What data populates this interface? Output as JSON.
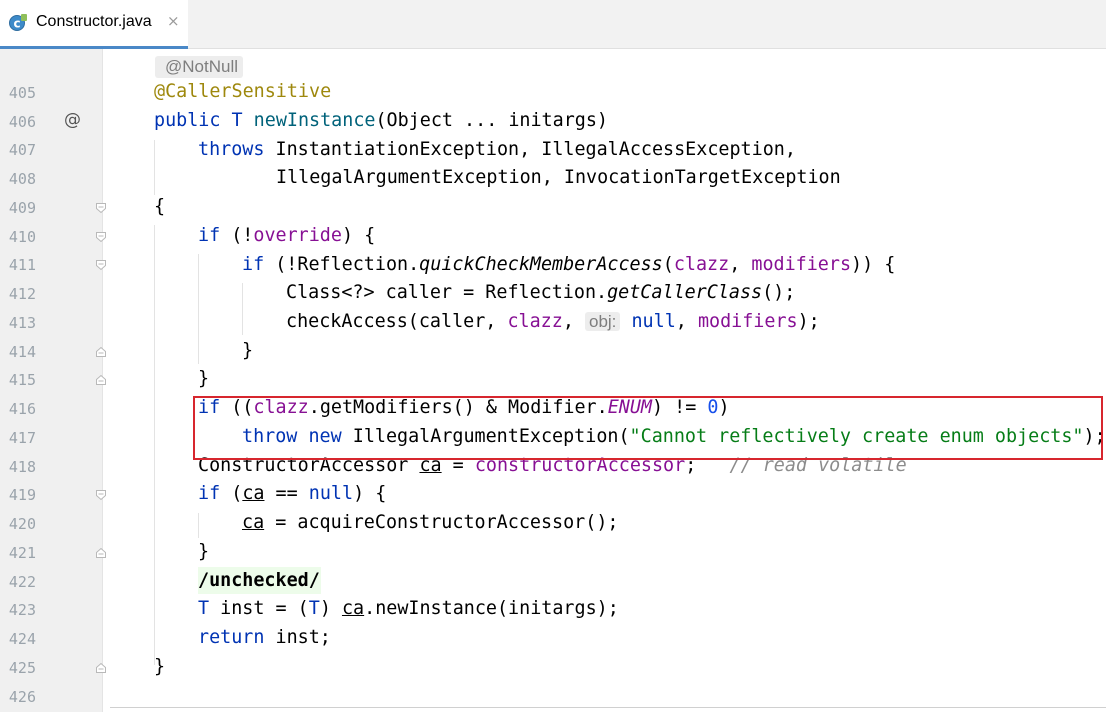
{
  "tab": {
    "title": "Constructor.java",
    "close_glyph": "×",
    "icon": "java-class-icon"
  },
  "gutter": {
    "line_numbers": [
      "405",
      "406",
      "407",
      "408",
      "409",
      "410",
      "411",
      "412",
      "413",
      "414",
      "415",
      "416",
      "417",
      "418",
      "419",
      "420",
      "421",
      "422",
      "423",
      "424",
      "425",
      "426"
    ],
    "override_marker": "@"
  },
  "hints": {
    "notnull": "@NotNull",
    "param_obj": "obj:"
  },
  "code": {
    "l405": {
      "annotation": "@CallerSensitive"
    },
    "l406": {
      "kw_public": "public",
      "type": "T",
      "method": "newInstance",
      "rest": "(Object ... initargs)"
    },
    "l407": {
      "kw_throws": "throws",
      "rest": "InstantiationException, IllegalAccessException,"
    },
    "l408": {
      "rest": "IllegalArgumentException, InvocationTargetException"
    },
    "l409": {
      "text": "{"
    },
    "l410": {
      "kw_if": "if",
      "p1": " (!",
      "field": "override",
      "p2": ") {"
    },
    "l411": {
      "kw_if": "if",
      "p1": " (!Reflection.",
      "method": "quickCheckMemberAccess",
      "p2": "(",
      "f1": "clazz",
      "p3": ", ",
      "f2": "modifiers",
      "p4": ")) {"
    },
    "l412": {
      "p1": "Class<?> caller = Reflection.",
      "method": "getCallerClass",
      "p2": "();"
    },
    "l413": {
      "p1": "checkAccess(caller, ",
      "f1": "clazz",
      "p2": ", ",
      "kw_null": "null",
      "p3": ", ",
      "f2": "modifiers",
      "p4": ");"
    },
    "l414": {
      "text": "}"
    },
    "l415": {
      "text": "}"
    },
    "l416": {
      "kw_if": "if",
      "p1": " ((",
      "f1": "clazz",
      "p2": ".getModifiers() & Modifier.",
      "const": "ENUM",
      "p3": ") != ",
      "num": "0",
      "p4": ")"
    },
    "l417": {
      "kw_throw": "throw",
      "kw_new": "new",
      "p1": " IllegalArgumentException(",
      "str": "\"Cannot reflectively create enum objects\"",
      "p2": ");"
    },
    "l418": {
      "p1": "ConstructorAccessor ",
      "var": "ca",
      "p2": " = ",
      "field": "constructorAccessor",
      "p3": ";",
      "comment": "// read volatile"
    },
    "l419": {
      "kw_if": "if",
      "p1": " (",
      "var": "ca",
      "p2": " == ",
      "kw_null": "null",
      "p3": ") {"
    },
    "l420": {
      "var": "ca",
      "p1": " = acquireConstructorAccessor();"
    },
    "l421": {
      "text": "}"
    },
    "l422": {
      "text": "/unchecked/"
    },
    "l423": {
      "type": "T",
      "p1": " inst = (",
      "type2": "T",
      "p2": ") ",
      "var": "ca",
      "p3": ".newInstance(initargs);"
    },
    "l424": {
      "kw_return": "return",
      "p1": " inst;"
    },
    "l425": {
      "text": "}"
    }
  },
  "colors": {
    "keyword": "#0033b3",
    "annotation": "#9e880d",
    "field": "#871094",
    "string": "#067d17",
    "number": "#1750eb",
    "comment": "#8c8c8c",
    "highlight_box": "#d7262e"
  }
}
